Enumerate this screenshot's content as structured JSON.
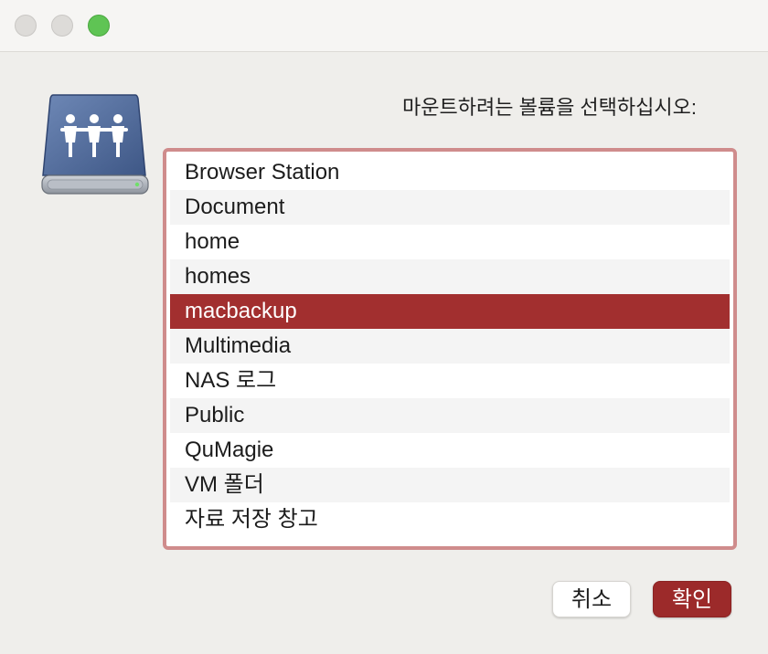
{
  "window": {
    "buttons": [
      "close",
      "minimize",
      "zoom"
    ]
  },
  "dialog": {
    "prompt": "마운트하려는 볼륨을 선택하십시오:",
    "icon": "shared-network-drive-icon",
    "volumes": [
      {
        "label": "Browser Station",
        "selected": false
      },
      {
        "label": "Document",
        "selected": false
      },
      {
        "label": "home",
        "selected": false
      },
      {
        "label": "homes",
        "selected": false
      },
      {
        "label": "macbackup",
        "selected": true
      },
      {
        "label": "Multimedia",
        "selected": false
      },
      {
        "label": "NAS 로그",
        "selected": false
      },
      {
        "label": "Public",
        "selected": false
      },
      {
        "label": "QuMagie",
        "selected": false
      },
      {
        "label": "VM 폴더",
        "selected": false
      },
      {
        "label": "자료 저장 창고",
        "selected": false
      }
    ],
    "cancel_label": "취소",
    "ok_label": "확인"
  },
  "colors": {
    "accent": "#a22f2f",
    "focus_ring": "#cf8c8c",
    "zoom_button": "#5fc454"
  }
}
